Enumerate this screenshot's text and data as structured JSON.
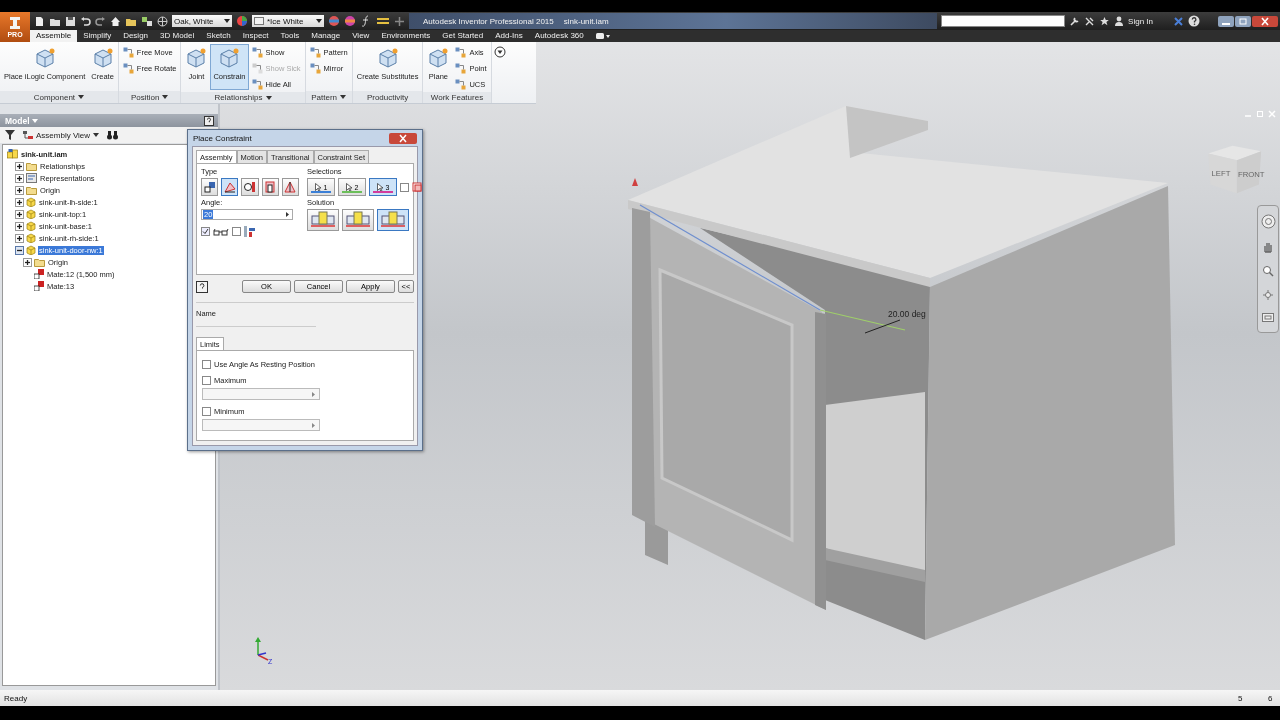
{
  "app_button": {
    "badge": "PRO"
  },
  "quick_access": {
    "material": "Oak, White",
    "appearance": "*Ice White"
  },
  "title_bar": {
    "app": "Autodesk Inventor Professional 2015",
    "file": "sink-unit.iam",
    "sign_in": "Sign In"
  },
  "tabs": [
    {
      "label": "Assemble",
      "selected": true
    },
    {
      "label": "Simplify",
      "selected": false
    },
    {
      "label": "Design",
      "selected": false
    },
    {
      "label": "3D Model",
      "selected": false
    },
    {
      "label": "Sketch",
      "selected": false
    },
    {
      "label": "Inspect",
      "selected": false
    },
    {
      "label": "Tools",
      "selected": false
    },
    {
      "label": "Manage",
      "selected": false
    },
    {
      "label": "View",
      "selected": false
    },
    {
      "label": "Environments",
      "selected": false
    },
    {
      "label": "Get Started",
      "selected": false
    },
    {
      "label": "Add-Ins",
      "selected": false
    },
    {
      "label": "Autodesk 360",
      "selected": false
    }
  ],
  "ribbon": [
    {
      "title": "Component",
      "menu": true,
      "columns": [
        [
          {
            "label": "Place iLogic Component",
            "kind": "large",
            "selected": false,
            "disabled": false
          }
        ],
        [
          {
            "label": "Create",
            "kind": "large",
            "selected": false,
            "disabled": false
          }
        ]
      ]
    },
    {
      "title": "Position",
      "menu": true,
      "columns": [
        [
          {
            "label": "Free Move",
            "kind": "small",
            "selected": false,
            "disabled": false
          },
          {
            "label": "Free Rotate",
            "kind": "small",
            "selected": false,
            "disabled": false
          }
        ]
      ]
    },
    {
      "title": "Relationships",
      "menu": true,
      "columns": [
        [
          {
            "label": "Joint",
            "kind": "large",
            "selected": false,
            "disabled": false
          }
        ],
        [
          {
            "label": "Constrain",
            "kind": "large",
            "selected": true,
            "disabled": false
          }
        ],
        [
          {
            "label": "Show",
            "kind": "small",
            "selected": false,
            "disabled": false
          },
          {
            "label": "Show Sick",
            "kind": "small",
            "selected": false,
            "disabled": true
          },
          {
            "label": "Hide All",
            "kind": "small",
            "selected": false,
            "disabled": false
          }
        ]
      ]
    },
    {
      "title": "Pattern",
      "menu": true,
      "columns": [
        [
          {
            "label": "Pattern",
            "kind": "small",
            "selected": false,
            "disabled": false
          },
          {
            "label": "Mirror",
            "kind": "small",
            "selected": false,
            "disabled": false
          }
        ]
      ]
    },
    {
      "title": "Productivity",
      "menu": false,
      "columns": [
        [
          {
            "label": "Create Substitutes",
            "kind": "large",
            "selected": false,
            "disabled": false
          }
        ]
      ]
    },
    {
      "title": "Work Features",
      "menu": false,
      "columns": [
        [
          {
            "label": "Plane",
            "kind": "large",
            "selected": false,
            "disabled": false
          }
        ],
        [
          {
            "label": "Axis",
            "kind": "small",
            "selected": false,
            "disabled": false
          },
          {
            "label": "Point",
            "kind": "small",
            "selected": false,
            "disabled": false
          },
          {
            "label": "UCS",
            "kind": "small",
            "selected": false,
            "disabled": false
          }
        ]
      ]
    }
  ],
  "browser": {
    "title": "Model",
    "view": "Assembly View",
    "tree": [
      {
        "label": "sink-unit.iam",
        "kind": "assembly",
        "selected": false,
        "children": [
          {
            "label": "Relationships",
            "kind": "folder",
            "expanded": false,
            "selected": false
          },
          {
            "label": "Representations",
            "kind": "representations",
            "expanded": false,
            "selected": false
          },
          {
            "label": "Origin",
            "kind": "folder",
            "expanded": false,
            "selected": false
          },
          {
            "label": "sink-unit-lh-side:1",
            "kind": "part",
            "expanded": false,
            "selected": false
          },
          {
            "label": "sink-unit-top:1",
            "kind": "part",
            "expanded": false,
            "selected": false
          },
          {
            "label": "sink-unit-base:1",
            "kind": "part",
            "expanded": false,
            "selected": false
          },
          {
            "label": "sink-unit-rh-side:1",
            "kind": "part",
            "expanded": false,
            "selected": false
          },
          {
            "label": "sink-unit-door-nw:1",
            "kind": "part",
            "expanded": true,
            "selected": true,
            "children": [
              {
                "label": "Origin",
                "kind": "folder",
                "expanded": false,
                "selected": false
              },
              {
                "label": "Mate:12 (1,500 mm)",
                "kind": "constraint",
                "selected": false
              },
              {
                "label": "Mate:13",
                "kind": "constraint",
                "selected": false
              }
            ]
          }
        ]
      }
    ]
  },
  "dialog": {
    "title": "Place Constraint",
    "tabs": [
      {
        "label": "Assembly",
        "selected": true
      },
      {
        "label": "Motion",
        "selected": false
      },
      {
        "label": "Transitional",
        "selected": false
      },
      {
        "label": "Constraint Set",
        "selected": false
      }
    ],
    "type_label": "Type",
    "types": [
      {
        "kind": "mate",
        "selected": false
      },
      {
        "kind": "angle",
        "selected": true
      },
      {
        "kind": "tangent",
        "selected": false
      },
      {
        "kind": "insert",
        "selected": false
      },
      {
        "kind": "symmetry",
        "selected": false
      }
    ],
    "selections_label": "Selections",
    "selections": [
      {
        "label": "1",
        "color": "#3b7fd6",
        "selected": false
      },
      {
        "label": "2",
        "color": "#6cbf5a",
        "selected": false
      },
      {
        "label": "3",
        "color": "#d23c9e",
        "selected": true
      }
    ],
    "pick_first": {
      "checked": false
    },
    "angle": {
      "label": "Angle:",
      "value": "20"
    },
    "solution_label": "Solution",
    "solutions": [
      {
        "selected": false
      },
      {
        "selected": false
      },
      {
        "selected": true
      }
    ],
    "preview": {
      "checked": true
    },
    "predict_offset": {
      "checked": false
    },
    "buttons": [
      "OK",
      "Cancel",
      "Apply"
    ],
    "collapse": "<<",
    "name_label": "Name",
    "limits_tab": "Limits",
    "resting": {
      "label": "Use Angle As Resting Position",
      "checked": false
    },
    "limits": [
      {
        "label": "Maximum",
        "checked": false
      },
      {
        "label": "Minimum",
        "checked": false
      }
    ]
  },
  "viewport": {
    "dimension": "20.00 deg",
    "cube_faces": [
      "LEFT",
      "FRONT"
    ],
    "triad_label": "Z"
  },
  "status_bar": {
    "message": "Ready",
    "values": [
      "5",
      "6"
    ]
  }
}
